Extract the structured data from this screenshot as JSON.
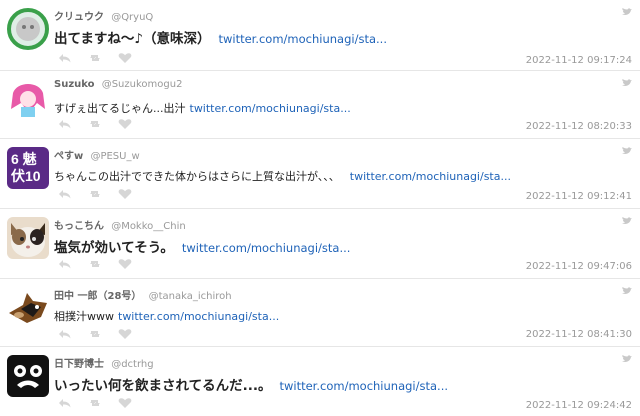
{
  "tweets": [
    {
      "name": "クリュウク",
      "handle": "@QryuQ",
      "text": "出てますね〜♪（意味深）",
      "link": "twitter.com/mochiunagi/sta...",
      "timestamp": "2022-11-12 09:17:24",
      "style": "big"
    },
    {
      "name": "Suzuko",
      "handle": "@Suzukomogu2",
      "text": "すげぇ出てるじゃん...出汁",
      "link": "twitter.com/mochiunagi/sta...",
      "timestamp": "2022-11-12 08:20:33",
      "style": "small"
    },
    {
      "name": "ぺすw",
      "handle": "@PESU_w",
      "text": "ちゃんこの出汁でできた体からはさらに上質な出汁が、、、",
      "link": "twitter.com/mochiunagi/sta...",
      "timestamp": "2022-11-12 09:12:41",
      "style": "small",
      "avatar_text": "6 魅 伏10"
    },
    {
      "name": "もっこちん",
      "handle": "@Mokko__Chin",
      "text": "塩気が効いてそう。",
      "link": "twitter.com/mochiunagi/sta...",
      "timestamp": "2022-11-12 09:47:06",
      "style": "big"
    },
    {
      "name": "田中 一郎（28号）",
      "handle": "@tanaka_ichiroh",
      "text": "相撲汁www",
      "link": "twitter.com/mochiunagi/sta...",
      "timestamp": "2022-11-12 08:41:30",
      "style": "small"
    },
    {
      "name": "日下野博士",
      "handle": "@dctrhg",
      "text": "いったい何を飲まされてるんだ...。",
      "link": "twitter.com/mochiunagi/sta...",
      "timestamp": "2022-11-12 09:24:42",
      "style": "big"
    }
  ],
  "icons": {
    "reply": "reply-icon",
    "retweet": "retweet-icon",
    "like": "heart-icon",
    "service": "twitter-bird-icon"
  },
  "colors": {
    "link": "#1f63b8",
    "meta": "#999999",
    "icon": "#d6d6d6"
  }
}
